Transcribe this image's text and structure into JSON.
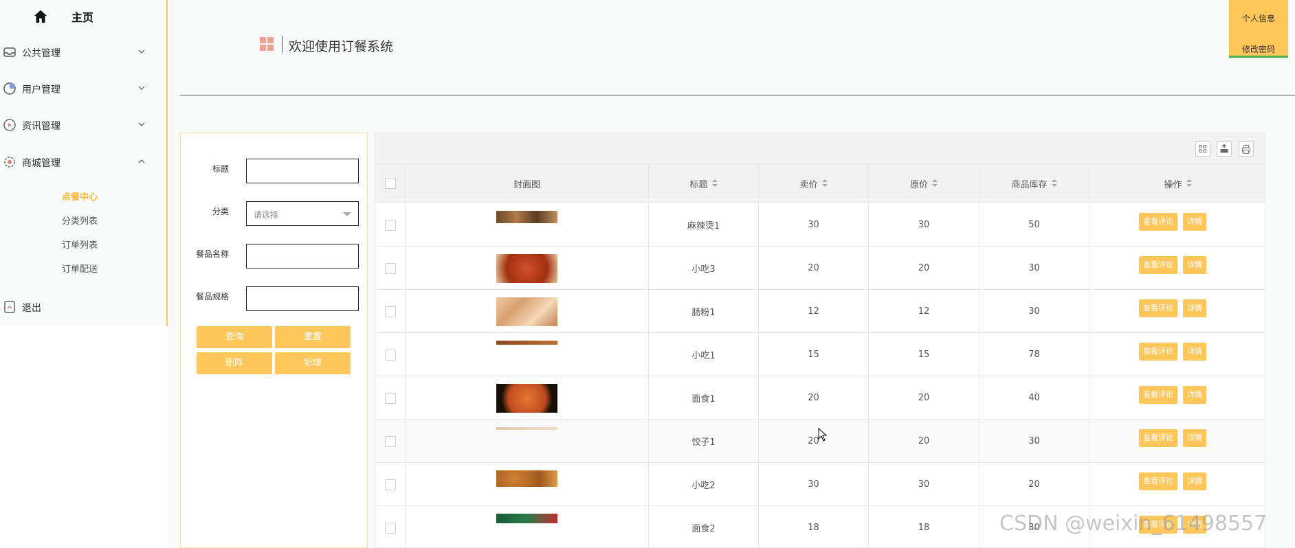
{
  "sidebar": {
    "home": "主页",
    "menus": [
      {
        "label": "公共管理",
        "icon": "inbox-icon"
      },
      {
        "label": "用户管理",
        "icon": "clock-icon"
      },
      {
        "label": "资讯管理",
        "icon": "play-circle-icon"
      },
      {
        "label": "商城管理",
        "icon": "settings-flower-icon"
      }
    ],
    "submenu": [
      "点餐中心",
      "分类列表",
      "订单列表",
      "订单配送"
    ],
    "active_submenu": "点餐中心",
    "logout": "退出"
  },
  "user_box": {
    "profile": "个人信息",
    "change_password": "修改密码"
  },
  "header": {
    "title": "欢迎使用订餐系统"
  },
  "search": {
    "title_label": "标题",
    "category_label": "分类",
    "category_placeholder": "请选择",
    "meal_name_label": "餐品名称",
    "meal_spec_label": "餐品规格",
    "query": "查询",
    "reset": "重置",
    "delete": "删除",
    "add": "新增"
  },
  "table": {
    "headers": [
      "封面图",
      "标题",
      "卖价",
      "原价",
      "商品库存",
      "操作"
    ],
    "view_comments": "查看评论",
    "details": "详情",
    "rows": [
      {
        "title": "麻辣烫1",
        "price": "30",
        "original": "30",
        "stock": "50"
      },
      {
        "title": "小吃3",
        "price": "20",
        "original": "20",
        "stock": "30"
      },
      {
        "title": "肠粉1",
        "price": "12",
        "original": "12",
        "stock": "30"
      },
      {
        "title": "小吃1",
        "price": "15",
        "original": "15",
        "stock": "78"
      },
      {
        "title": "面食1",
        "price": "20",
        "original": "20",
        "stock": "40"
      },
      {
        "title": "饺子1",
        "price": "20",
        "original": "20",
        "stock": "30"
      },
      {
        "title": "小吃2",
        "price": "30",
        "original": "30",
        "stock": "20"
      },
      {
        "title": "面食2",
        "price": "18",
        "original": "18",
        "stock": "30"
      }
    ]
  },
  "watermark": "CSDN @weixin_61498557",
  "colors": {
    "accent": "#ffc65c",
    "active": "#ffb83a"
  }
}
